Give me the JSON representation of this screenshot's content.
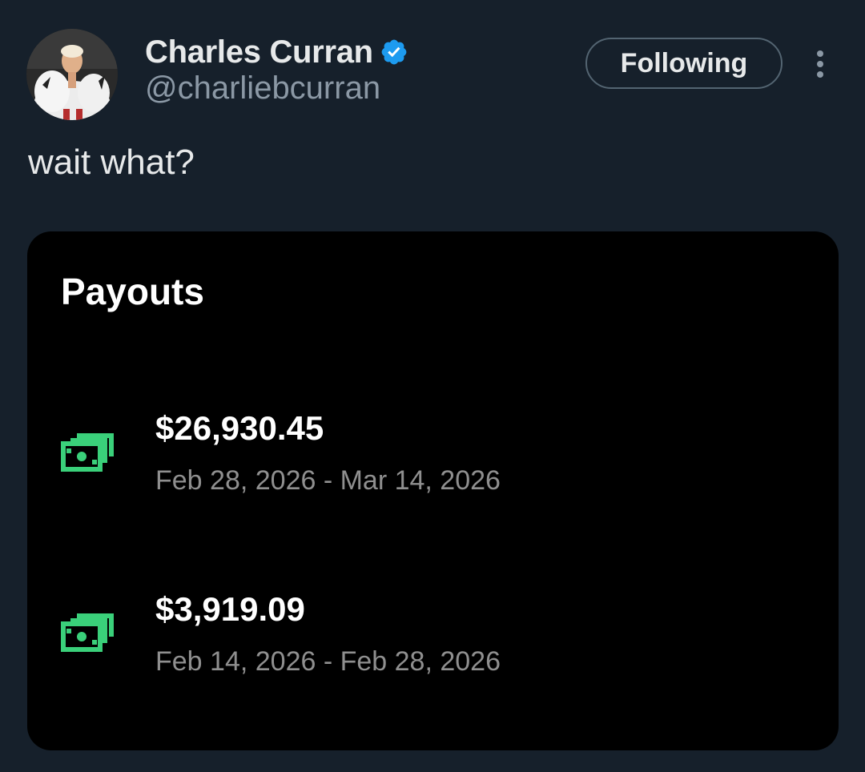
{
  "author": {
    "display_name": "Charles Curran",
    "handle": "@charliebcurran",
    "verified_icon": "verified-badge-icon"
  },
  "actions": {
    "follow_label": "Following",
    "more_icon": "more-options-icon"
  },
  "tweet": {
    "text": "wait what?"
  },
  "payouts_card": {
    "title": "Payouts",
    "items": [
      {
        "amount": "$26,930.45",
        "range": "Feb 28, 2026 - Mar 14, 2026",
        "icon": "money-icon"
      },
      {
        "amount": "$3,919.09",
        "range": "Feb 14, 2026 - Feb 28, 2026",
        "icon": "money-icon"
      }
    ]
  },
  "colors": {
    "background": "#16202b",
    "card": "#000000",
    "verified_blue": "#1d9bf0",
    "money_green": "#3ad07a",
    "secondary_text": "#8b98a5"
  }
}
